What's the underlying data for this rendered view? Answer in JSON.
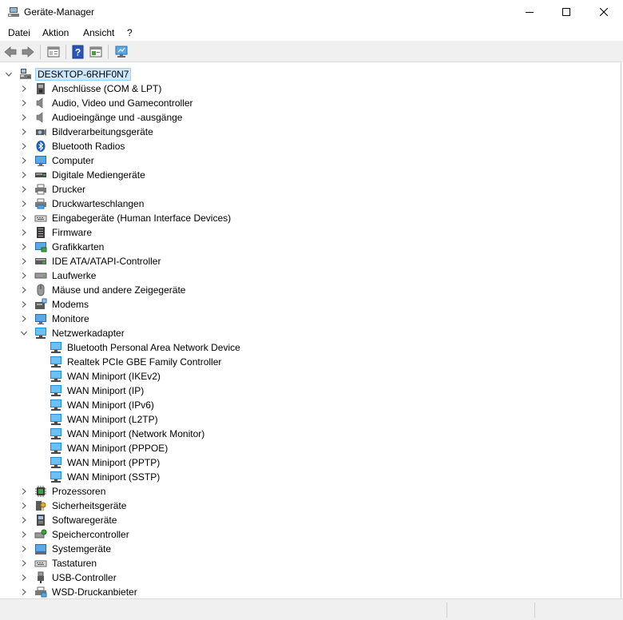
{
  "window": {
    "title": "Geräte-Manager",
    "controls": [
      "minimize",
      "maximize",
      "close"
    ]
  },
  "menu": [
    {
      "label": "Datei"
    },
    {
      "label": "Aktion"
    },
    {
      "label": "Ansicht"
    },
    {
      "label": "?"
    }
  ],
  "toolbar": {
    "buttons": [
      "back-arrow-icon",
      "forward-arrow-icon",
      "properties-icon",
      "help-icon",
      "show-hidden-icon",
      "scan-hardware-icon"
    ]
  },
  "tree": {
    "root": {
      "label": "DESKTOP-6RHF0N7",
      "icon": "computer-icon",
      "expanded": true,
      "selected": true
    },
    "categories": [
      {
        "label": "Anschlüsse (COM & LPT)",
        "icon": "port-icon"
      },
      {
        "label": "Audio, Video und Gamecontroller",
        "icon": "speaker-icon"
      },
      {
        "label": "Audioeingänge und -ausgänge",
        "icon": "speaker-icon"
      },
      {
        "label": "Bildverarbeitungsgeräte",
        "icon": "camera-icon"
      },
      {
        "label": "Bluetooth Radios",
        "icon": "bluetooth-icon"
      },
      {
        "label": "Computer",
        "icon": "monitor-icon"
      },
      {
        "label": "Digitale Mediengeräte",
        "icon": "media-device-icon"
      },
      {
        "label": "Drucker",
        "icon": "printer-icon"
      },
      {
        "label": "Druckwarteschlangen",
        "icon": "printer-queue-icon"
      },
      {
        "label": "Eingabegeräte (Human Interface Devices)",
        "icon": "keyboard-icon"
      },
      {
        "label": "Firmware",
        "icon": "firmware-icon"
      },
      {
        "label": "Grafikkarten",
        "icon": "display-adapter-icon"
      },
      {
        "label": "IDE ATA/ATAPI-Controller",
        "icon": "ide-controller-icon"
      },
      {
        "label": "Laufwerke",
        "icon": "drive-icon"
      },
      {
        "label": "Mäuse und andere Zeigegeräte",
        "icon": "mouse-icon"
      },
      {
        "label": "Modems",
        "icon": "modem-icon"
      },
      {
        "label": "Monitore",
        "icon": "monitor-icon"
      },
      {
        "label": "Netzwerkadapter",
        "icon": "network-adapter-icon",
        "expanded": true,
        "children": [
          {
            "label": "Bluetooth Personal Area Network Device"
          },
          {
            "label": "Realtek PCIe GBE Family Controller"
          },
          {
            "label": "WAN Miniport (IKEv2)"
          },
          {
            "label": "WAN Miniport (IP)"
          },
          {
            "label": "WAN Miniport (IPv6)"
          },
          {
            "label": "WAN Miniport (L2TP)"
          },
          {
            "label": "WAN Miniport (Network Monitor)"
          },
          {
            "label": "WAN Miniport (PPPOE)"
          },
          {
            "label": "WAN Miniport (PPTP)"
          },
          {
            "label": "WAN Miniport (SSTP)"
          }
        ]
      },
      {
        "label": "Prozessoren",
        "icon": "processor-icon"
      },
      {
        "label": "Sicherheitsgeräte",
        "icon": "security-device-icon"
      },
      {
        "label": "Softwaregeräte",
        "icon": "software-device-icon"
      },
      {
        "label": "Speichercontroller",
        "icon": "storage-controller-icon"
      },
      {
        "label": "Systemgeräte",
        "icon": "system-device-icon"
      },
      {
        "label": "Tastaturen",
        "icon": "keyboard-icon"
      },
      {
        "label": "USB-Controller",
        "icon": "usb-icon"
      },
      {
        "label": "WSD-Druckanbieter",
        "icon": "wsd-printer-icon"
      }
    ]
  },
  "colors": {
    "selection_bg": "#cce8ff",
    "selection_border": "#99d1ff",
    "network_blue": "#1c8ee0"
  }
}
